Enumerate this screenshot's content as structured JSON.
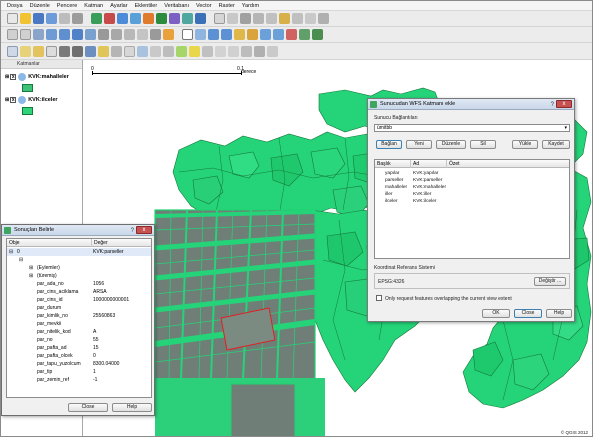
{
  "menubar": {
    "items": [
      "Dosya",
      "Düzenle",
      "Pencere",
      "Katman",
      "Ayarlar",
      "Eklentiler",
      "Veritabanı",
      "Vector",
      "Raster",
      "Yardım"
    ]
  },
  "layers_panel": {
    "title": "Katmanlar",
    "layers": [
      {
        "name": "KVK:mahalleler",
        "checked": "x",
        "swatch_color": "#3ec27a"
      },
      {
        "name": "KVK:ilceler",
        "checked": "x",
        "swatch_color": "#2fd47a"
      }
    ]
  },
  "map": {
    "scale_labels": [
      "0",
      "0.1"
    ],
    "scale_unit": "derece",
    "copyright": "© QGIS 2012",
    "colors": {
      "district_fill": "#25d379",
      "district_stroke": "#157a3a",
      "parcel_fill": "#6f7f78",
      "parcel_stroke": "#1fd36f",
      "highlight_stroke": "#e02020",
      "background": "#ffffff"
    }
  },
  "wfs_dialog": {
    "title": "Sunucudan WFS Katmanı ekle",
    "help_glyph": "?",
    "close_glyph": "x",
    "group_label": "Sunucu Bağlantıları",
    "connection_value": "ümitbb",
    "buttons": {
      "connect": "Bağlan",
      "new": "Yeni",
      "edit": "Düzenle",
      "delete": "Sil",
      "load": "Yükle",
      "save": "Kaydet"
    },
    "table_headers": [
      "Başlık",
      "Ad",
      "Özet"
    ],
    "rows": [
      {
        "title": "yapılar",
        "name": "KVK:yapılar"
      },
      {
        "title": "parseller",
        "name": "KVK:parseller"
      },
      {
        "title": "mahalleler",
        "name": "KVK:mahalleler"
      },
      {
        "title": "iller",
        "name": "KVK:iller"
      },
      {
        "title": "ilceler",
        "name": "KVK:ilceler"
      }
    ],
    "crs_label": "Koordinat Referans Sistemi",
    "crs_value": "EPSG:4326",
    "change_button": "Değiştir ...",
    "bbox_checkbox_label": "Only request features overlapping the current view extent",
    "ok": "OK",
    "close": "Close",
    "help": "Help"
  },
  "identify_dialog": {
    "title": "Sonuçları Belirle",
    "help_glyph": "?",
    "close_glyph": "x",
    "headers": [
      "Obje",
      "Değer"
    ],
    "top_row": {
      "key": "0",
      "value": "KVK:parseller"
    },
    "group_rows": [
      "(Eylemler)",
      "(türemiş)"
    ],
    "attributes": [
      {
        "key": "par_ada_no",
        "value": "1056"
      },
      {
        "key": "par_cins_aciklama",
        "value": "ARSA"
      },
      {
        "key": "par_cins_id",
        "value": "1000000000001"
      },
      {
        "key": "par_durum",
        "value": ""
      },
      {
        "key": "par_kimlik_no",
        "value": "25560863"
      },
      {
        "key": "par_mevkii",
        "value": ""
      },
      {
        "key": "par_nitelik_kod",
        "value": "A"
      },
      {
        "key": "par_no",
        "value": "55"
      },
      {
        "key": "par_pafta_ad",
        "value": "15"
      },
      {
        "key": "par_pafta_olcek",
        "value": "0"
      },
      {
        "key": "par_tapu_yuzolcum",
        "value": "8300.04000"
      },
      {
        "key": "par_tip",
        "value": "1"
      },
      {
        "key": "par_zemin_ref",
        "value": "-1"
      }
    ],
    "close": "Close",
    "help": "Help"
  }
}
